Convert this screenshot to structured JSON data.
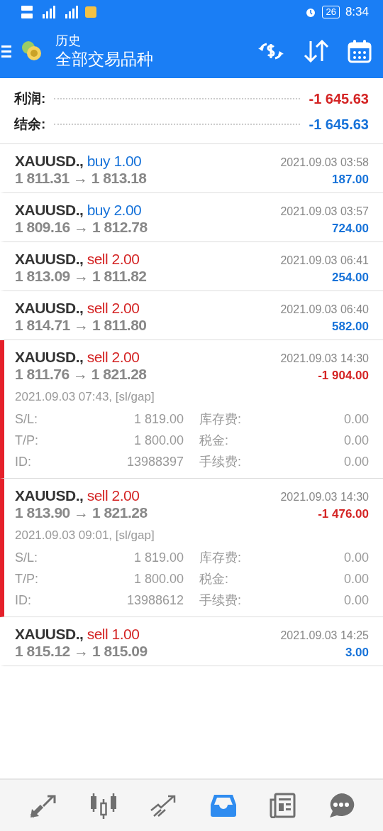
{
  "status_bar": {
    "battery": "26",
    "time": "8:34"
  },
  "header": {
    "title": "历史",
    "subtitle": "全部交易品种"
  },
  "summary": [
    {
      "label": "利润:",
      "value": "-1 645.63",
      "kind": "loss"
    },
    {
      "label": "结余:",
      "value": "-1 645.63",
      "kind": "balance"
    }
  ],
  "deals": [
    {
      "symbol": "XAUUSD.,",
      "side": "buy",
      "volume": "1.00",
      "prices": "1 811.31 → 1 813.18",
      "time": "2021.09.03 03:58",
      "profit": "187.00",
      "loss": false,
      "expanded": false
    },
    {
      "symbol": "XAUUSD.,",
      "side": "buy",
      "volume": "2.00",
      "prices": "1 809.16 → 1 812.78",
      "time": "2021.09.03 03:57",
      "profit": "724.00",
      "loss": false,
      "expanded": false
    },
    {
      "symbol": "XAUUSD.,",
      "side": "sell",
      "volume": "2.00",
      "prices": "1 813.09 → 1 811.82",
      "time": "2021.09.03 06:41",
      "profit": "254.00",
      "loss": false,
      "expanded": false
    },
    {
      "symbol": "XAUUSD.,",
      "side": "sell",
      "volume": "2.00",
      "prices": "1 814.71 → 1 811.80",
      "time": "2021.09.03 06:40",
      "profit": "582.00",
      "loss": false,
      "expanded": false
    },
    {
      "symbol": "XAUUSD.,",
      "side": "sell",
      "volume": "2.00",
      "prices": "1 811.76 → 1 821.28",
      "time": "2021.09.03 14:30",
      "profit": "-1 904.00",
      "loss": true,
      "expanded": true,
      "open_info": "2021.09.03 07:43, [sl/gap]",
      "details": [
        {
          "label": "S/L:",
          "value": "1 819.00",
          "label2": "库存费:",
          "value2": "0.00"
        },
        {
          "label": "T/P:",
          "value": "1 800.00",
          "label2": "税金:",
          "value2": "0.00"
        },
        {
          "label": "ID:",
          "value": "13988397",
          "label2": "手续费:",
          "value2": "0.00"
        }
      ]
    },
    {
      "symbol": "XAUUSD.,",
      "side": "sell",
      "volume": "2.00",
      "prices": "1 813.90 → 1 821.28",
      "time": "2021.09.03 14:30",
      "profit": "-1 476.00",
      "loss": true,
      "expanded": true,
      "open_info": "2021.09.03 09:01, [sl/gap]",
      "details": [
        {
          "label": "S/L:",
          "value": "1 819.00",
          "label2": "库存费:",
          "value2": "0.00"
        },
        {
          "label": "T/P:",
          "value": "1 800.00",
          "label2": "税金:",
          "value2": "0.00"
        },
        {
          "label": "ID:",
          "value": "13988612",
          "label2": "手续费:",
          "value2": "0.00"
        }
      ]
    },
    {
      "symbol": "XAUUSD.,",
      "side": "sell",
      "volume": "1.00",
      "prices": "1 815.12 → 1 815.09",
      "time": "2021.09.03 14:25",
      "profit": "3.00",
      "loss": false,
      "expanded": false
    }
  ],
  "bottom_nav": [
    {
      "kind": "quotes",
      "selected": false
    },
    {
      "kind": "chart",
      "selected": false
    },
    {
      "kind": "trade",
      "selected": false
    },
    {
      "kind": "history",
      "selected": true
    },
    {
      "kind": "news",
      "selected": false
    },
    {
      "kind": "chat",
      "selected": false
    }
  ]
}
